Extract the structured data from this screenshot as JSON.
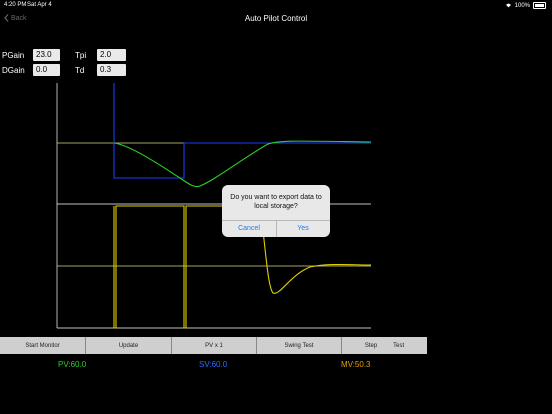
{
  "status_bar": {
    "time": "4:20 PM",
    "date": "Sat Apr 4",
    "battery": "100%"
  },
  "nav": {
    "back_label": "Back",
    "title": "Auto Pilot Control"
  },
  "params": {
    "pgain": {
      "label": "PGain",
      "value": "23.0"
    },
    "tpi": {
      "label": "Tpi",
      "value": "2.0"
    },
    "dgain": {
      "label": "DGain",
      "value": "0.0"
    },
    "td": {
      "label": "Td",
      "value": "0.3"
    }
  },
  "colors": {
    "pv": "#2bd12b",
    "sv": "#1a3cff",
    "mv": "#e0d000",
    "gridline": "#d9d98a"
  },
  "toolbar": {
    "start_monitor": "Start Monitor",
    "update": "Update",
    "pv_x1": "PV x 1",
    "swing_test": "Swing Test",
    "step": "Step",
    "test": "Test"
  },
  "readouts": {
    "pv": "PV:60.0",
    "sv": "SV:60.0",
    "mv": "MV:50.3"
  },
  "dialog": {
    "message": "Do you want to export data to local storage?",
    "cancel": "Cancel",
    "yes": "Yes"
  }
}
